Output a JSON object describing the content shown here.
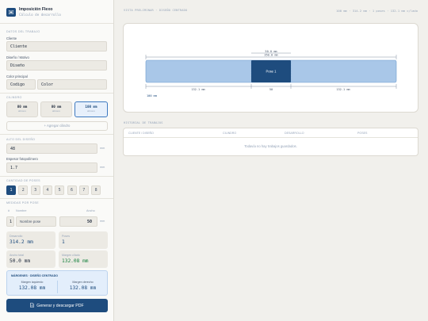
{
  "app": {
    "title": "Imposición Flexo",
    "subtitle": "Cálculo de desarrollo"
  },
  "work": {
    "section": "DATOS DEL TRABAJO",
    "client_label": "Cliente",
    "client_value": "Cliente",
    "design_label": "Diseño / Motivo",
    "design_value": "Diseño",
    "color_label": "Color principal",
    "color_code": "Codigo",
    "color_value": "Color"
  },
  "cylinder": {
    "section": "CILINDRO",
    "options": [
      {
        "value": "80 mm",
        "sub": "ab/vero",
        "selected": false
      },
      {
        "value": "80 mm",
        "sub": "ab/vero",
        "selected": false
      },
      {
        "value": "100 mm",
        "sub": "ab/vero",
        "selected": true
      }
    ],
    "add_label": "+ Agregar cilindro"
  },
  "height": {
    "section": "ALTO DEL DISEÑO",
    "value": "48",
    "unit": "mm"
  },
  "thickness": {
    "label": "Espesor fotopolímero",
    "value": "1.7",
    "unit": "mm"
  },
  "poses": {
    "section": "CANTIDAD DE POSES",
    "options": [
      "1",
      "2",
      "3",
      "4",
      "5",
      "6",
      "7",
      "8"
    ],
    "selected_index": 0
  },
  "measures": {
    "section": "MEDIDAS POR POSE",
    "col_num": "#",
    "col_name": "Nombre",
    "col_width": "Ancho",
    "row": {
      "num": "1",
      "name": "Nombre pose",
      "width": "50",
      "unit": "mm"
    }
  },
  "stats": {
    "development_label": "Desarrollo",
    "development_value": "314.2 mm",
    "poses_label": "Poses",
    "poses_value": "1",
    "used_label": "Ancho total",
    "used_value": "50.0 mm",
    "margin_label": "Margen c/lado",
    "margin_value": "132.08 mm"
  },
  "margins": {
    "title": "MÁRGENES · DISEÑO CENTRADO",
    "left_label": "Margen izquierdo",
    "left_value": "132.08 mm",
    "right_label": "Margen derecho",
    "right_value": "132.08 mm"
  },
  "generate_label": "Generar y descargar PDF",
  "preview": {
    "title": "VISTA PRELIMINAR · DISEÑO CENTRADO",
    "summary": "100 mm · 314.2 mm · 1 poses · 132.1 mm c/lado",
    "dim_top_a": "50.0 mm",
    "dim_top_b": "350.0 mm",
    "pose_label": "Pose 1",
    "dim_left": "132.1 mm",
    "dim_mid": "50",
    "dim_right": "132.1 mm",
    "height_label": "100 mm"
  },
  "history": {
    "title": "HISTORIAL DE TRABAJOS",
    "columns": [
      "CLIENTE / DISEÑO",
      "CILINDRO",
      "DESARROLLO",
      "POSES"
    ],
    "empty": "Todavía no hay trabajos guardados."
  },
  "colors": {
    "accent": "#1e4c7e",
    "accent_light": "#a9c7e8",
    "pose_fill": "#1e4c7e"
  }
}
